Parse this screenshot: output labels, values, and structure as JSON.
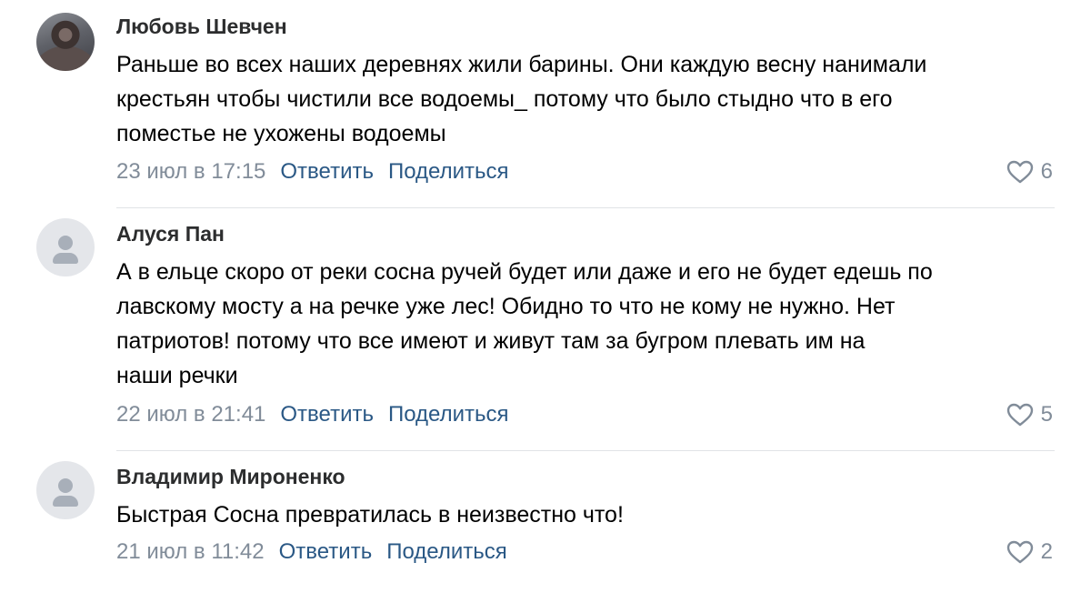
{
  "comments": [
    {
      "author": "Любовь Шевчен",
      "avatar": "photo",
      "text": "Раньше во всех наших деревнях жили барины. Они каждую весну нанимали\nкрестьян чтобы чистили все водоемы_ потому что было стыдно что в его\nпоместье не ухожены водоемы",
      "date": "23 июл в 17:15",
      "reply_label": "Ответить",
      "share_label": "Поделиться",
      "likes": "6",
      "like_icon": "heart-outline-icon"
    },
    {
      "author": "Алуся Пан",
      "avatar": "default-user",
      "text": "А в ельце скоро от реки сосна ручей будет или даже и его не будет едешь по\nлавскому мосту а на речке уже лес! Обидно то что не кому не нужно. Нет\nпатриотов! потому что все имеют и живут там за бугром плевать им на\nнаши речки",
      "date": "22 июл в 21:41",
      "reply_label": "Ответить",
      "share_label": "Поделиться",
      "likes": "5",
      "like_icon": "heart-outline-icon"
    },
    {
      "author": "Владимир Мироненко",
      "avatar": "default-user",
      "text": "Быстрая Сосна превратилась в неизвестно что!",
      "date": "21 июл в 11:42",
      "reply_label": "Ответить",
      "share_label": "Поделиться",
      "likes": "2",
      "like_icon": "heart-outline-icon"
    }
  ],
  "colors": {
    "author": "#2c2d2e",
    "text": "#000000",
    "meta": "#818c99",
    "action": "#2a5885",
    "divider": "#e1e3e6"
  }
}
